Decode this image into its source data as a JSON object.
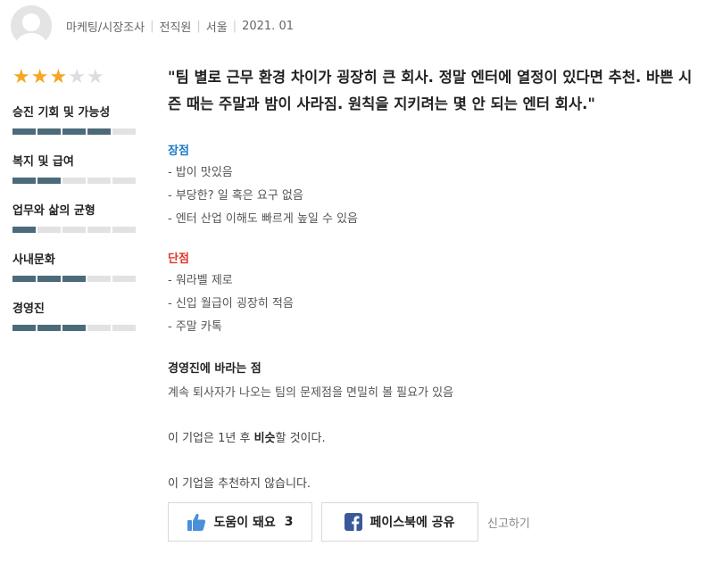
{
  "header": {
    "job": "마케팅/시장조사",
    "status": "전직원",
    "location": "서울",
    "date": "2021. 01"
  },
  "rating": {
    "stars": 3,
    "max_stars": 5,
    "star_color": "#f5a623",
    "categories": [
      {
        "label": "승진 기회 및 가능성",
        "score": 4
      },
      {
        "label": "복지 및 급여",
        "score": 2
      },
      {
        "label": "업무와 삶의 균형",
        "score": 1
      },
      {
        "label": "사내문화",
        "score": 3
      },
      {
        "label": "경영진",
        "score": 3
      }
    ]
  },
  "review": {
    "headline": "\"팀 별로 근무 환경 차이가 굉장히 큰 회사. 정말 엔터에 열정이 있다면 추천. 바쁜 시즌 때는 주말과 밤이 사라짐. 원칙을 지키려는 몇 안 되는 엔터 회사.\"",
    "pros_title": "장점",
    "pros": [
      "- 밥이 맛있음",
      "- 부당한? 일 혹은 요구 없음",
      "- 엔터 산업 이해도 빠르게 높일 수 있음"
    ],
    "cons_title": "단점",
    "cons": [
      "- 워라벨 제로",
      "- 신입 월급이 굉장히 적음",
      "- 주말 카톡"
    ],
    "advice_title": "경영진에 바라는 점",
    "advice": "계속 퇴사자가 나오는 팀의 문제점을 면밀히 볼 필요가 있음",
    "outlook_prefix": "이 기업은 1년 후 ",
    "outlook_value": "비슷",
    "outlook_suffix": "할 것이다.",
    "recommend": "이 기업을 추천하지 않습니다."
  },
  "actions": {
    "helpful_label": "도움이 돼요",
    "helpful_count": "3",
    "share_label": "페이스북에 공유",
    "report_label": "신고하기"
  },
  "colors": {
    "accent_bar": "#4c6b7a",
    "pros": "#1a7ac5",
    "cons": "#e0352a",
    "facebook": "#3b5998",
    "thumb": "#4a90d9"
  },
  "icons": [
    "avatar-icon",
    "star-icon",
    "thumbs-up-icon",
    "facebook-icon"
  ]
}
